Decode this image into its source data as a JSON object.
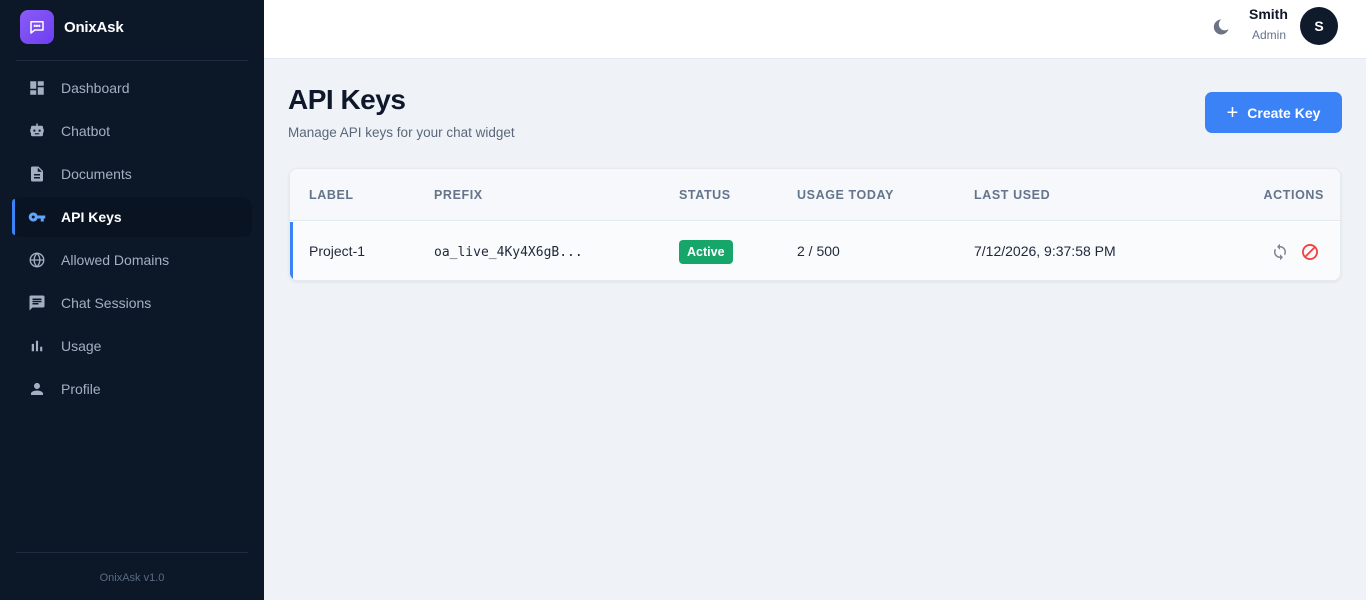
{
  "brand": {
    "name": "OnixAsk",
    "icon": "chat-bubble-icon"
  },
  "sidebar": {
    "items": [
      {
        "label": "Dashboard",
        "icon": "dashboard-icon"
      },
      {
        "label": "Chatbot",
        "icon": "robot-icon"
      },
      {
        "label": "Documents",
        "icon": "document-icon"
      },
      {
        "label": "API Keys",
        "icon": "key-icon",
        "active": true
      },
      {
        "label": "Allowed Domains",
        "icon": "globe-icon"
      },
      {
        "label": "Chat Sessions",
        "icon": "chat-icon"
      },
      {
        "label": "Usage",
        "icon": "bar-chart-icon"
      },
      {
        "label": "Profile",
        "icon": "person-icon"
      }
    ],
    "version": "OnixAsk v1.0"
  },
  "header": {
    "theme_toggle_icon": "moon-icon",
    "user": {
      "name": "Smith",
      "role": "Admin",
      "initial": "S"
    }
  },
  "main": {
    "title": "API Keys",
    "subtitle": "Manage API keys for your chat widget",
    "create_button": "Create Key",
    "table": {
      "columns": [
        "LABEL",
        "PREFIX",
        "STATUS",
        "USAGE TODAY",
        "LAST USED",
        "ACTIONS"
      ],
      "rows": [
        {
          "label": "Project-1",
          "prefix": "oa_live_4Ky4X6gB...",
          "status": "Active",
          "usage_today": "2 / 500",
          "last_used": "7/12/2026, 9:37:58 PM",
          "actions": [
            "rotate-icon",
            "revoke-icon"
          ]
        }
      ]
    }
  },
  "colors": {
    "sidebar_bg": "#0c1828",
    "accent": "#3b82f6",
    "brand": "#7c4dff",
    "status_active": "#16a66a",
    "danger": "#ef4444"
  }
}
